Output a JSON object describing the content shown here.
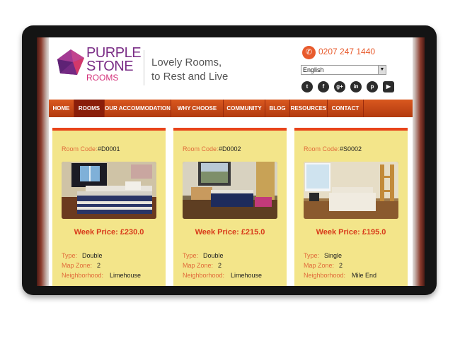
{
  "brand": {
    "line1": "PURPLE",
    "line2": "STONE",
    "line3": "ROOMS",
    "tagline_1": "Lovely Rooms,",
    "tagline_2": "to Rest and Live",
    "logo_icon": "purple-gem-icon"
  },
  "contact": {
    "phone": "0207 247 1440",
    "phone_icon": "phone-icon"
  },
  "language": {
    "selected": "English"
  },
  "socials": [
    {
      "icon": "twitter-icon",
      "glyph": "t"
    },
    {
      "icon": "facebook-icon",
      "glyph": "f"
    },
    {
      "icon": "google-plus-icon",
      "glyph": "g+"
    },
    {
      "icon": "linkedin-icon",
      "glyph": "in"
    },
    {
      "icon": "pinterest-icon",
      "glyph": "p"
    },
    {
      "icon": "youtube-icon",
      "glyph": "▶"
    }
  ],
  "nav": {
    "items": [
      {
        "label": "HOME"
      },
      {
        "label": "ROOMS"
      },
      {
        "label": "OUR ACCOMMODATION"
      },
      {
        "label": "WHY CHOOSE US?"
      },
      {
        "label": "COMMUNITY"
      },
      {
        "label": "BLOG"
      },
      {
        "label": "RESOURCES"
      },
      {
        "label": "CONTACT"
      }
    ],
    "active_index": 1
  },
  "labels": {
    "room_code": "Room Code:",
    "type": "Type:",
    "map_zone": "Map Zone:",
    "neighborhood": "Neighborhood:"
  },
  "rooms": [
    {
      "code": "#D0001",
      "price": "Week Price: £230.0",
      "type": "Double",
      "zone": "2",
      "neighborhood": "Limehouse"
    },
    {
      "code": "#D0002",
      "price": "Week Price: £215.0",
      "type": "Double",
      "zone": "2",
      "neighborhood": "Limehouse"
    },
    {
      "code": "#S0002",
      "price": "Week Price: £195.0",
      "type": "Single",
      "zone": "2",
      "neighborhood": "Mile End"
    }
  ],
  "colors": {
    "accent_orange": "#e8431a",
    "nav_red": "#b23a0f",
    "brand_purple": "#7a2d86",
    "card_yellow": "#f3e58a"
  }
}
